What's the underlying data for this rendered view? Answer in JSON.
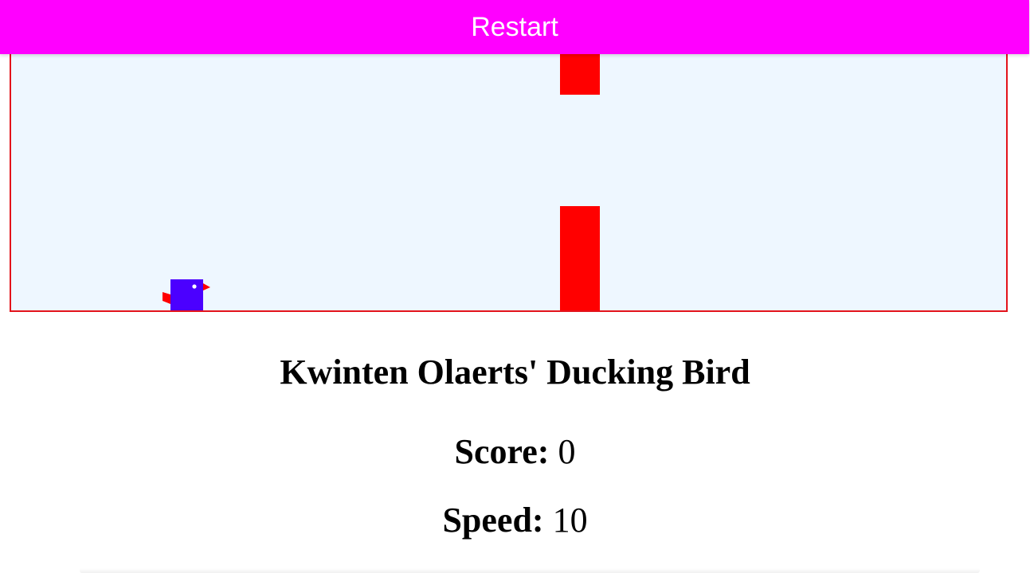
{
  "restart_button": {
    "label": "Restart"
  },
  "game": {
    "title": "Kwinten Olaerts' Ducking Bird",
    "score_label": "Score:",
    "score_value": "0",
    "speed_label": "Speed:",
    "speed_value": "10"
  },
  "colors": {
    "restart_bg": "#ff00ff",
    "pipe": "#ff0000",
    "bird_body": "#4b00ff",
    "bird_beak": "#ff0000",
    "sky": "#eef7ff",
    "frame_border": "#e3131b"
  }
}
